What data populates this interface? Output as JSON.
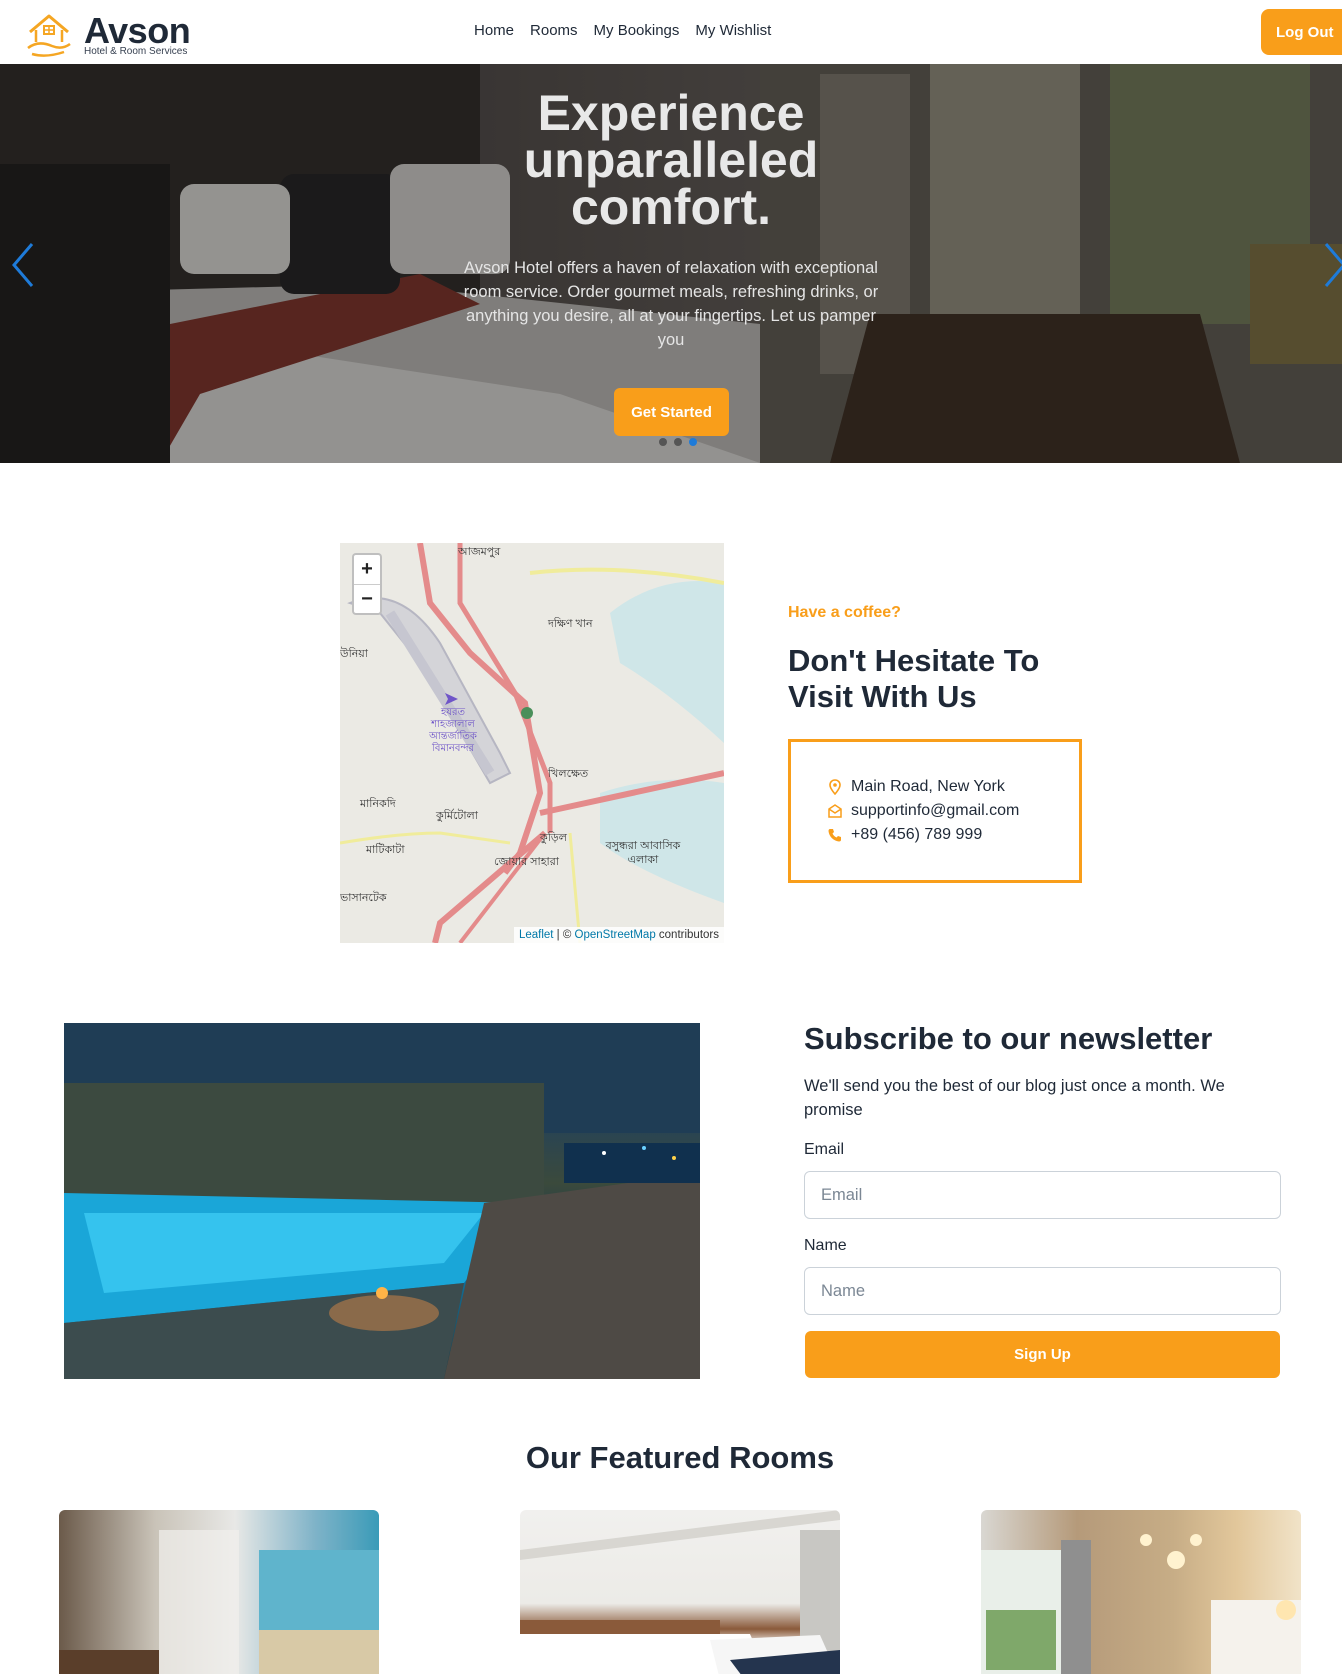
{
  "brand": {
    "name": "Avson",
    "tagline": "Hotel & Room Services",
    "accent": "#f99e1a"
  },
  "nav": {
    "links": [
      "Home",
      "Rooms",
      "My Bookings",
      "My Wishlist"
    ],
    "logout_label": "Log Out"
  },
  "hero": {
    "title": "Experience unparalleled comfort.",
    "text": "Avson Hotel offers a haven of relaxation with exceptional room service. Order gourmet meals, refreshing drinks, or anything you desire, all at your fingertips. Let us pamper you",
    "cta_label": "Get Started",
    "slide_count": 3,
    "active_slide": 3
  },
  "map": {
    "zoom_in": "+",
    "zoom_out": "−",
    "attribution": {
      "leaflet": "Leaflet",
      "separator": " | © ",
      "osm": "OpenStreetMap",
      "suffix": " contributors"
    },
    "labels": [
      "আজমপুর",
      "দক্ষিণ খান",
      "উনিয়া",
      "হযরত শাহজালাল আন্তর্জাতিক বিমানবন্দর",
      "খিলক্ষেত",
      "মানিকদি",
      "কুর্মিটোলা",
      "কুড়িল",
      "মাটিকাটা",
      "বসুন্ধরা আবাসিক এলাকা",
      "জোয়ার সাহারা",
      "ভাসানটেক"
    ]
  },
  "visit": {
    "kicker": "Have a coffee?",
    "title": "Don't Hesitate To Visit With Us",
    "address": "Main Road, New York",
    "email": "supportinfo@gmail.com",
    "phone": "+89 (456) 789 999"
  },
  "newsletter": {
    "title": "Subscribe to our newsletter",
    "text": "We'll send you the best of our blog just once a month. We promise",
    "email_label": "Email",
    "email_placeholder": "Email",
    "name_label": "Name",
    "name_placeholder": "Name",
    "submit_label": "Sign Up"
  },
  "featured": {
    "title": "Our Featured Rooms"
  }
}
